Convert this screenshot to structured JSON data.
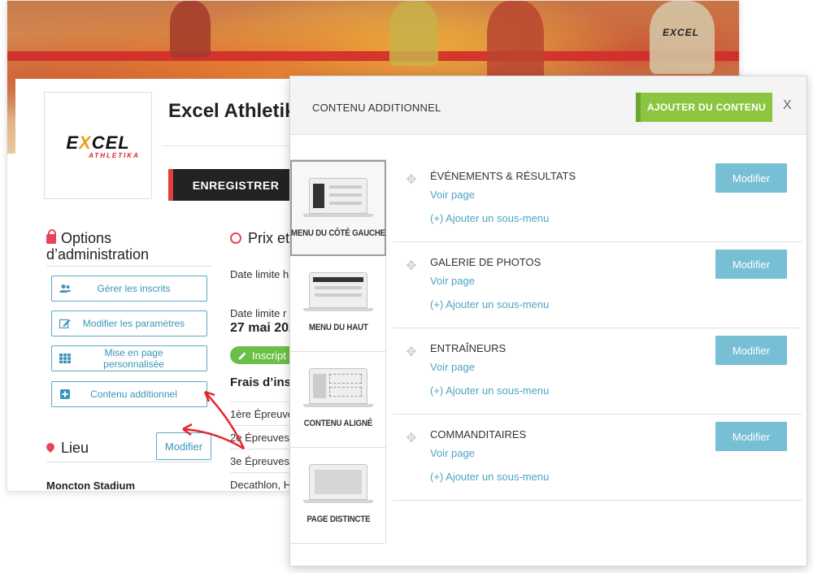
{
  "site": {
    "title": "Excel Athletik",
    "logo_main": "EXCEL",
    "logo_sub": "ATHLETIKA",
    "banner_logo": "EXCEL",
    "register_label": "ENREGISTRER"
  },
  "admin": {
    "title": "Options d’administration",
    "buttons": [
      {
        "icon": "users-icon",
        "label": "Gérer les inscrits"
      },
      {
        "icon": "edit-icon",
        "label": "Modifier les paramètres"
      },
      {
        "icon": "grid-icon",
        "label": "Mise en page personnalisée"
      },
      {
        "icon": "plus-square-icon",
        "label": "Contenu additionnel"
      }
    ]
  },
  "lieu": {
    "title": "Lieu",
    "modify_label": "Modifier",
    "venue": "Moncton Stadium"
  },
  "prix": {
    "title": "Prix et",
    "date_limit_1": "Date limite h",
    "date_limit_2": "Date limite r",
    "date_value": "27 mai 202",
    "inscription_label": "Inscript",
    "fees_title": "Frais d’insc",
    "fees": [
      "1ère Épreuves",
      "2e Épreuves",
      "3e Épreuves",
      "Decathlon, H"
    ]
  },
  "modal": {
    "title": "CONTENU ADDITIONNEL",
    "add_label": "AJOUTER DU CONTENU",
    "close_label": "X",
    "layouts": [
      {
        "label": "MENU DU CÔTÉ GAUCHE",
        "selected": true
      },
      {
        "label": "MENU DU HAUT",
        "selected": false
      },
      {
        "label": "CONTENU ALIGNÉ",
        "selected": false
      },
      {
        "label": "PAGE DISTINCTE",
        "selected": false
      }
    ],
    "menus": [
      {
        "name": "ÉVÉNEMENTS & RÉSULTATS",
        "view": "Voir page",
        "sub": "(+) Ajouter un sous-menu",
        "modify": "Modifier"
      },
      {
        "name": "GALERIE DE PHOTOS",
        "view": "Voir page",
        "sub": "(+) Ajouter un sous-menu",
        "modify": "Modifier"
      },
      {
        "name": "ENTRAÎNEURS",
        "view": "Voir page",
        "sub": "(+) Ajouter un sous-menu",
        "modify": "Modifier"
      },
      {
        "name": "COMMANDITAIRES",
        "view": "Voir page",
        "sub": "(+) Ajouter un sous-menu",
        "modify": "Modifier"
      }
    ]
  },
  "colors": {
    "accent_blue": "#77bfd5",
    "link_blue": "#4ea5c4",
    "green": "#8cc540",
    "red": "#e43d3d"
  }
}
